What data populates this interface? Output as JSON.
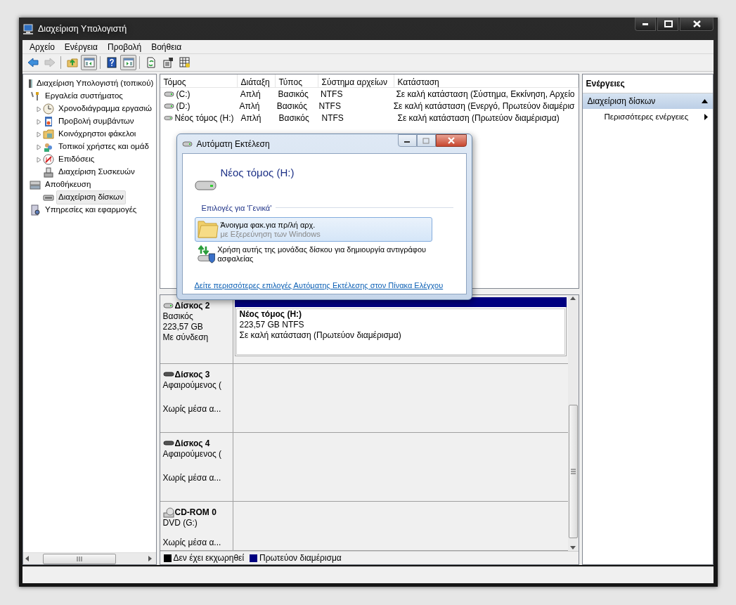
{
  "window": {
    "title": "Διαχείριση Υπολογιστή"
  },
  "menu": [
    "Αρχείο",
    "Ενέργεια",
    "Προβολή",
    "Βοήθεια"
  ],
  "toolbar": [
    [
      {
        "disabled": false,
        "pressed": false
      },
      {
        "disabled": true,
        "pressed": false
      }
    ],
    [
      {
        "disabled": false,
        "pressed": false
      },
      {
        "disabled": false,
        "pressed": true
      }
    ],
    [
      {
        "disabled": false,
        "pressed": false
      },
      {
        "disabled": false,
        "pressed": true
      }
    ],
    [
      {
        "disabled": false,
        "pressed": false
      },
      {
        "disabled": false,
        "pressed": false
      },
      {
        "disabled": false,
        "pressed": false
      }
    ]
  ],
  "tree": [
    {
      "label": "Διαχείριση Υπολογιστή (τοπικού)",
      "collapsed": false,
      "selected": false,
      "children": [
        {
          "label": "Εργαλεία συστήματος",
          "collapsed": false,
          "selected": false,
          "children": [
            {
              "label": "Χρονοδιάγραμμα εργασιώ",
              "collapsed": true,
              "selected": false
            },
            {
              "label": "Προβολή συμβάντων",
              "collapsed": true,
              "selected": false
            },
            {
              "label": "Κοινόχρηστοι φάκελοι",
              "collapsed": true,
              "selected": false
            },
            {
              "label": "Τοπικοί χρήστες και ομάδ",
              "collapsed": true,
              "selected": false
            },
            {
              "label": "Επιδόσεις",
              "collapsed": true,
              "selected": false
            },
            {
              "label": "Διαχείριση Συσκευών",
              "collapsed": false,
              "selected": false
            }
          ]
        },
        {
          "label": "Αποθήκευση",
          "collapsed": false,
          "selected": false,
          "children": [
            {
              "label": "Διαχείριση δίσκων",
              "collapsed": false,
              "selected": true
            }
          ]
        },
        {
          "label": "Υπηρεσίες και εφαρμογές",
          "collapsed": false,
          "selected": false
        }
      ]
    }
  ],
  "volumes": {
    "columns": [
      "Τόμος",
      "Διάταξη",
      "Τύπος",
      "Σύστημα αρχείων",
      "Κατάσταση"
    ],
    "rows": [
      [
        "(C:)",
        "Απλή",
        "Βασικός",
        "NTFS",
        "Σε καλή κατάσταση (Σύστημα, Εκκίνηση, Αρχείο"
      ],
      [
        "(D:)",
        "Απλή",
        "Βασικός",
        "NTFS",
        "Σε καλή κατάσταση (Ενεργό, Πρωτεύον διαμέρισ"
      ],
      [
        "Νέος τόμος (H:)",
        "Απλή",
        "Βασικός",
        "NTFS",
        "Σε καλή κατάσταση (Πρωτεύον διαμέρισμα)"
      ]
    ]
  },
  "disks": [
    {
      "kind": "basic",
      "name": "Δίσκος 2",
      "type": "Βασικός",
      "size": "223,57 GB",
      "status": "Με σύνδεση",
      "partitions": [
        {
          "name": "Νέος τόμος  (H:)",
          "size": "223,57 GB NTFS",
          "status": "Σε καλή κατάσταση (Πρωτεύον διαμέρισμα)",
          "color": "#000080"
        }
      ]
    },
    {
      "kind": "removable",
      "name": "Δίσκος 3",
      "type": "Αφαιρούμενος (",
      "status": "Χωρίς μέσα α..."
    },
    {
      "kind": "removable",
      "name": "Δίσκος 4",
      "type": "Αφαιρούμενος (",
      "status": "Χωρίς μέσα α..."
    },
    {
      "kind": "cdrom",
      "name": "CD-ROM 0",
      "type": "DVD (G:)",
      "status": "Χωρίς μέσα α..."
    }
  ],
  "legend": [
    {
      "label": "Δεν έχει εκχωρηθεί",
      "color": "#000000"
    },
    {
      "label": "Πρωτεύον διαμέρισμα",
      "color": "#000080"
    }
  ],
  "actions": {
    "title": "Ενέργειες",
    "sections": [
      {
        "label": "Διαχείριση δίσκων",
        "expanded": true,
        "items": [
          "Περισσότερες ενέργειες"
        ]
      }
    ]
  },
  "dialog": {
    "title": "Αυτόματη Εκτέλεση",
    "drive": "Νέος τόμος (H:)",
    "group": "Επιλογές για 'Γενικά'",
    "options": [
      {
        "title": "Άνοιγμα φακ.για πρ/λή αρχ.",
        "subtitle": "με Εξερεύνηση των Windows",
        "selected": true
      },
      {
        "title": "Χρήση αυτής της μονάδας δίσκου για δημιουργία αντιγράφου ασφαλείας",
        "selected": false
      }
    ],
    "link": "Δείτε περισσότερες επιλογές Αυτόματης Εκτέλεσης στον Πίνακα Ελέγχου"
  }
}
